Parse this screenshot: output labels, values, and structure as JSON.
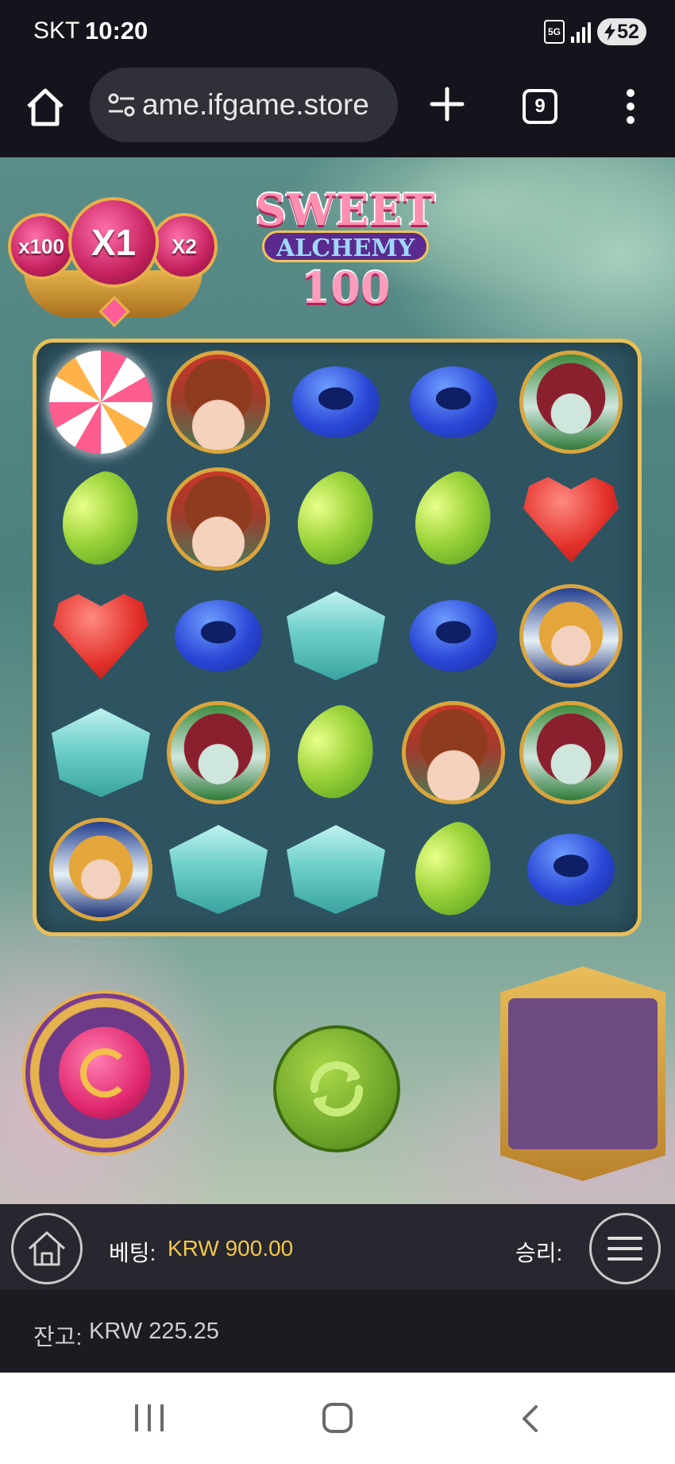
{
  "status_bar": {
    "carrier": "SKT",
    "time": "10:20",
    "network": "5G",
    "battery": "52"
  },
  "browser": {
    "url": "ame.ifgame.store",
    "tab_count": "9"
  },
  "game": {
    "logo": {
      "line1": "SWEET",
      "line2": "ALCHEMY",
      "line3": "100"
    },
    "multipliers": {
      "left": "x100",
      "current": "X1",
      "right": "X2"
    },
    "grid": [
      [
        "candy",
        "portrait-red",
        "donut",
        "donut",
        "portrait-green"
      ],
      [
        "bean",
        "portrait-red",
        "bean",
        "bean",
        "heart"
      ],
      [
        "heart",
        "donut",
        "gem",
        "donut",
        "portrait-blue"
      ],
      [
        "gem",
        "portrait-green",
        "bean",
        "portrait-red",
        "portrait-green"
      ],
      [
        "portrait-blue",
        "gem",
        "gem",
        "bean",
        "donut"
      ]
    ]
  },
  "info_bar": {
    "bet_label": "베팅:",
    "bet_value": "KRW 900.00",
    "win_label": "승리:"
  },
  "balance_bar": {
    "balance_label": "잔고:",
    "balance_value": "KRW 225.25"
  },
  "colors": {
    "bet_accent": "#f2c84b",
    "board_frame": "#e8bf58",
    "spin_green": "#6fa52a"
  }
}
